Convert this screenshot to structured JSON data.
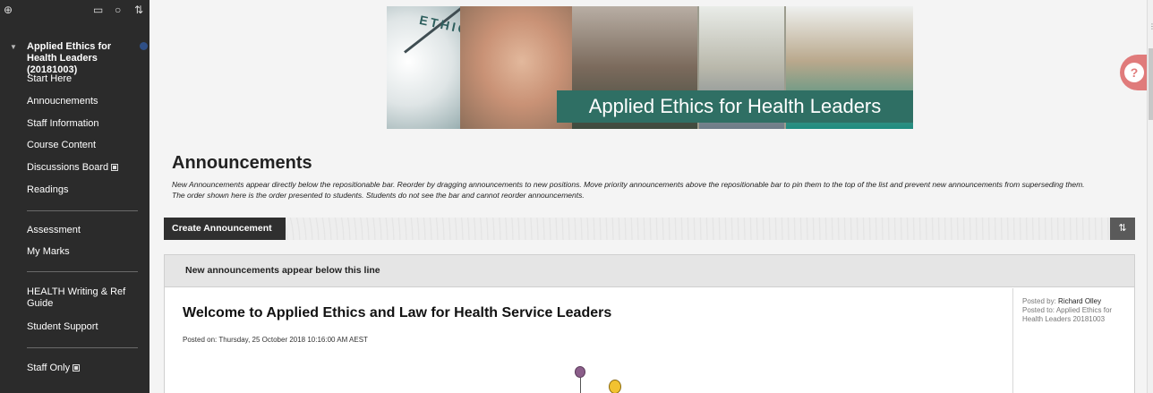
{
  "sidebar": {
    "tools": {
      "add": "⊕",
      "folder": "▭",
      "refresh": "○",
      "reorder": "⇅"
    },
    "course_title": "Applied Ethics for Health Leaders (20181003)",
    "items": [
      {
        "label": "Start Here"
      },
      {
        "label": "Annoucnements"
      },
      {
        "label": "Staff Information"
      },
      {
        "label": "Course Content"
      },
      {
        "label": "Discussions Board"
      },
      {
        "label": "Readings"
      },
      {
        "label": "Assessment"
      },
      {
        "label": "My Marks"
      },
      {
        "label": "HEALTH Writing & Ref Guide"
      },
      {
        "label": "Student Support"
      },
      {
        "label": "Staff Only"
      }
    ]
  },
  "banner": {
    "word": "ETHICS",
    "title": "Applied Ethics for Health Leaders"
  },
  "help": {
    "glyph": "?"
  },
  "page": {
    "title": "Announcements",
    "description": "New Announcements appear directly below the repositionable bar. Reorder by dragging announcements to new positions. Move priority announcements above the repositionable bar to pin them to the top of the list and prevent new announcements from superseding them. The order shown here is the order presented to students. Students do not see the bar and cannot reorder announcements."
  },
  "actionbar": {
    "create_label": "Create Announcement",
    "reorder_glyph": "⇅"
  },
  "list": {
    "divider_label": "New announcements appear below this line",
    "announcement": {
      "title": "Welcome to Applied Ethics and Law for Health Service Leaders",
      "posted_on": "Posted on: Thursday, 25 October 2018 10:16:00 AM AEST",
      "posted_by_label": "Posted by:",
      "posted_by": "Richard Olley",
      "posted_to_label": "Posted to:",
      "posted_to": "Applied Ethics for Health Leaders 20181003"
    }
  },
  "colors": {
    "sidebar_bg": "#2b2b2b",
    "banner_titlebar": "#2f6f64",
    "help_button": "#e07b7b",
    "action_button": "#2f2f2f"
  }
}
